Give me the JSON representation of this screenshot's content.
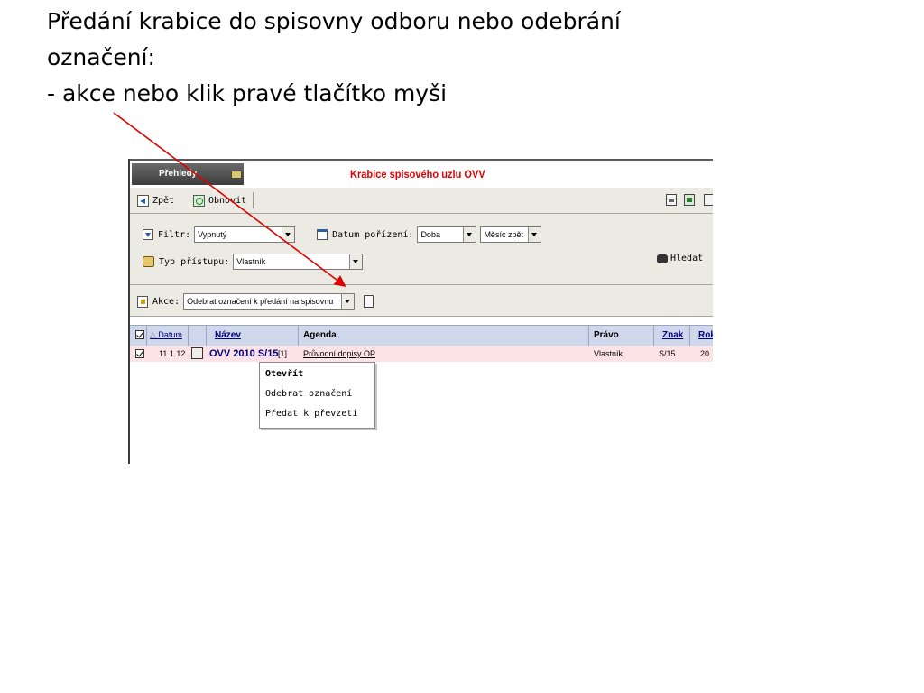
{
  "slide": {
    "line1": "Předání krabice do spisovny odboru nebo odebrání",
    "line2": "označení:",
    "line3": "- akce nebo klik pravé tlačítko myši"
  },
  "app": {
    "tab_label": "Přehledy",
    "title": "Krabice spisového uzlu OVV",
    "toolbar": {
      "back": "Zpět",
      "refresh": "Obnovit"
    },
    "filters": {
      "filter_label": "Filtr:",
      "filter_value": "Vypnutý",
      "date_label": "Datum pořízení:",
      "date_value": "Doba",
      "period_value": "Měsíc zpět",
      "access_label": "Typ přístupu:",
      "access_value": "Vlastník",
      "search_label": "Hledat"
    },
    "action": {
      "label": "Akce:",
      "value": "Odebrat označení k předání na spisovnu"
    },
    "columns": {
      "date": "Datum",
      "name": "Název",
      "agenda": "Agenda",
      "right": "Právo",
      "mark": "Znak",
      "year": "Rok"
    },
    "rows": [
      {
        "date": "11.1.12",
        "name": "OVV 2010 S/15",
        "count": "[1]",
        "agenda": "Průvodní dopisy OP",
        "right": "Vlastník",
        "mark": "S/15",
        "year": "20"
      }
    ],
    "context_menu": {
      "open": "Otevřít",
      "remove_mark": "Odebrat označení",
      "hand_over": "Předat k převzetí"
    }
  },
  "colors": {
    "title_red": "#e00000",
    "link_blue": "#000080",
    "row_pink": "#fde3e6",
    "header_blue": "#cfd8ea",
    "arrow_red": "#e00000"
  }
}
